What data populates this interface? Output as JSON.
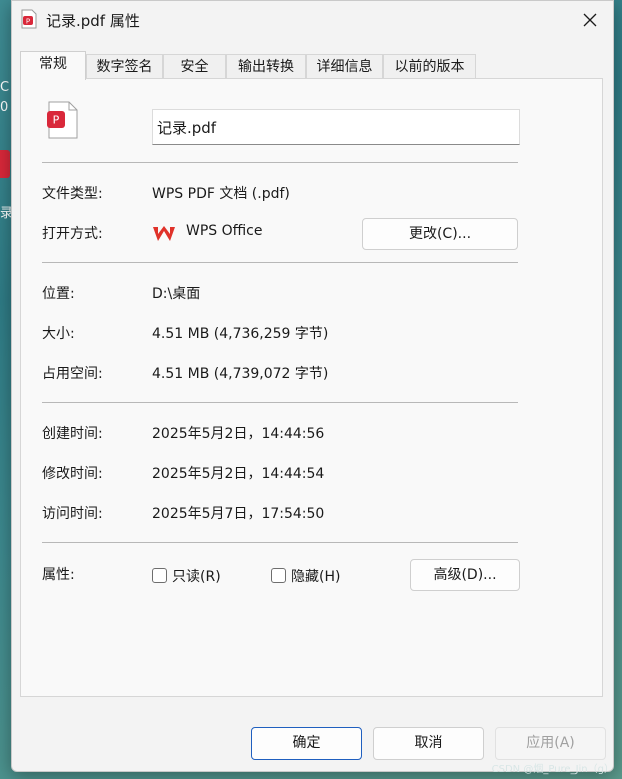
{
  "desktop": {
    "fragments": [
      "C",
      "0",
      "录"
    ]
  },
  "window": {
    "title": "记录.pdf 属性",
    "close_icon": "close-icon"
  },
  "tabs": [
    {
      "label": "常规",
      "active": true
    },
    {
      "label": "数字签名",
      "active": false
    },
    {
      "label": "安全",
      "active": false
    },
    {
      "label": "输出转换",
      "active": false
    },
    {
      "label": "详细信息",
      "active": false
    },
    {
      "label": "以前的版本",
      "active": false
    }
  ],
  "general": {
    "file_name": "记录.pdf",
    "file_type_label": "文件类型:",
    "file_type_value": "WPS PDF 文档 (.pdf)",
    "opens_with_label": "打开方式:",
    "opens_with_value": "WPS Office",
    "change_button": "更改(C)...",
    "location_label": "位置:",
    "location_value": "D:\\桌面",
    "size_label": "大小:",
    "size_value": "4.51 MB (4,736,259 字节)",
    "size_on_disk_label": "占用空间:",
    "size_on_disk_value": "4.51 MB (4,739,072 字节)",
    "created_label": "创建时间:",
    "created_value": "2025年5月2日，14:44:56",
    "modified_label": "修改时间:",
    "modified_value": "2025年5月2日，14:44:54",
    "accessed_label": "访问时间:",
    "accessed_value": "2025年5月7日，17:54:50",
    "attributes_label": "属性:",
    "readonly_label": "只读(R)",
    "readonly_checked": false,
    "hidden_label": "隐藏(H)",
    "hidden_checked": false,
    "advanced_button": "高级(D)..."
  },
  "footer": {
    "ok": "确定",
    "cancel": "取消",
    "apply": "应用(A)"
  },
  "watermark": "CSDN @烟_Pure_Jin（g）",
  "colors": {
    "pdf_red": "#d9283a",
    "accent": "#1f5fbf"
  }
}
